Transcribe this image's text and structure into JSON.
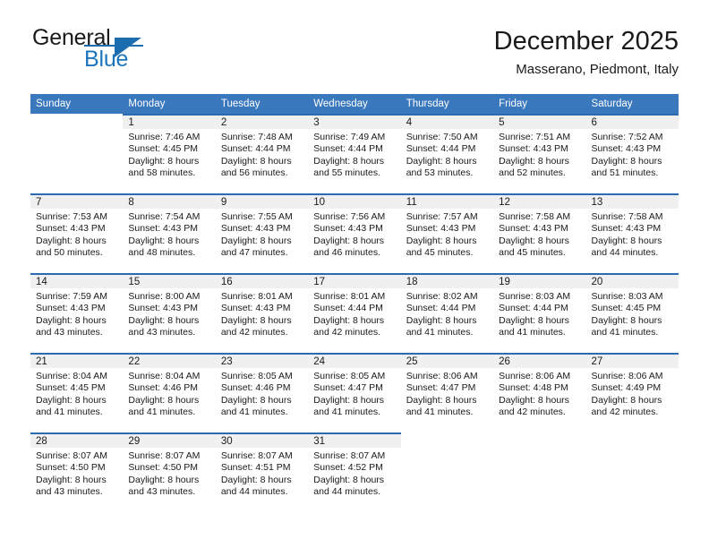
{
  "brand": {
    "name_part1": "General",
    "name_part2": "Blue",
    "logo_icon": "triangle-logo-icon",
    "accent_color": "#1c6cb0"
  },
  "header": {
    "month_title": "December 2025",
    "location": "Masserano, Piedmont, Italy"
  },
  "calendar": {
    "header_background": "#3a78bd",
    "daynum_band_background": "#f0f0f0",
    "daynum_band_border": "#2b6cb0",
    "weekday_headers": [
      "Sunday",
      "Monday",
      "Tuesday",
      "Wednesday",
      "Thursday",
      "Friday",
      "Saturday"
    ],
    "weeks": [
      [
        {
          "day": "",
          "sunrise": "",
          "sunset": "",
          "daylight_line1": "",
          "daylight_line2": ""
        },
        {
          "day": "1",
          "sunrise": "Sunrise: 7:46 AM",
          "sunset": "Sunset: 4:45 PM",
          "daylight_line1": "Daylight: 8 hours",
          "daylight_line2": "and 58 minutes."
        },
        {
          "day": "2",
          "sunrise": "Sunrise: 7:48 AM",
          "sunset": "Sunset: 4:44 PM",
          "daylight_line1": "Daylight: 8 hours",
          "daylight_line2": "and 56 minutes."
        },
        {
          "day": "3",
          "sunrise": "Sunrise: 7:49 AM",
          "sunset": "Sunset: 4:44 PM",
          "daylight_line1": "Daylight: 8 hours",
          "daylight_line2": "and 55 minutes."
        },
        {
          "day": "4",
          "sunrise": "Sunrise: 7:50 AM",
          "sunset": "Sunset: 4:44 PM",
          "daylight_line1": "Daylight: 8 hours",
          "daylight_line2": "and 53 minutes."
        },
        {
          "day": "5",
          "sunrise": "Sunrise: 7:51 AM",
          "sunset": "Sunset: 4:43 PM",
          "daylight_line1": "Daylight: 8 hours",
          "daylight_line2": "and 52 minutes."
        },
        {
          "day": "6",
          "sunrise": "Sunrise: 7:52 AM",
          "sunset": "Sunset: 4:43 PM",
          "daylight_line1": "Daylight: 8 hours",
          "daylight_line2": "and 51 minutes."
        }
      ],
      [
        {
          "day": "7",
          "sunrise": "Sunrise: 7:53 AM",
          "sunset": "Sunset: 4:43 PM",
          "daylight_line1": "Daylight: 8 hours",
          "daylight_line2": "and 50 minutes."
        },
        {
          "day": "8",
          "sunrise": "Sunrise: 7:54 AM",
          "sunset": "Sunset: 4:43 PM",
          "daylight_line1": "Daylight: 8 hours",
          "daylight_line2": "and 48 minutes."
        },
        {
          "day": "9",
          "sunrise": "Sunrise: 7:55 AM",
          "sunset": "Sunset: 4:43 PM",
          "daylight_line1": "Daylight: 8 hours",
          "daylight_line2": "and 47 minutes."
        },
        {
          "day": "10",
          "sunrise": "Sunrise: 7:56 AM",
          "sunset": "Sunset: 4:43 PM",
          "daylight_line1": "Daylight: 8 hours",
          "daylight_line2": "and 46 minutes."
        },
        {
          "day": "11",
          "sunrise": "Sunrise: 7:57 AM",
          "sunset": "Sunset: 4:43 PM",
          "daylight_line1": "Daylight: 8 hours",
          "daylight_line2": "and 45 minutes."
        },
        {
          "day": "12",
          "sunrise": "Sunrise: 7:58 AM",
          "sunset": "Sunset: 4:43 PM",
          "daylight_line1": "Daylight: 8 hours",
          "daylight_line2": "and 45 minutes."
        },
        {
          "day": "13",
          "sunrise": "Sunrise: 7:58 AM",
          "sunset": "Sunset: 4:43 PM",
          "daylight_line1": "Daylight: 8 hours",
          "daylight_line2": "and 44 minutes."
        }
      ],
      [
        {
          "day": "14",
          "sunrise": "Sunrise: 7:59 AM",
          "sunset": "Sunset: 4:43 PM",
          "daylight_line1": "Daylight: 8 hours",
          "daylight_line2": "and 43 minutes."
        },
        {
          "day": "15",
          "sunrise": "Sunrise: 8:00 AM",
          "sunset": "Sunset: 4:43 PM",
          "daylight_line1": "Daylight: 8 hours",
          "daylight_line2": "and 43 minutes."
        },
        {
          "day": "16",
          "sunrise": "Sunrise: 8:01 AM",
          "sunset": "Sunset: 4:43 PM",
          "daylight_line1": "Daylight: 8 hours",
          "daylight_line2": "and 42 minutes."
        },
        {
          "day": "17",
          "sunrise": "Sunrise: 8:01 AM",
          "sunset": "Sunset: 4:44 PM",
          "daylight_line1": "Daylight: 8 hours",
          "daylight_line2": "and 42 minutes."
        },
        {
          "day": "18",
          "sunrise": "Sunrise: 8:02 AM",
          "sunset": "Sunset: 4:44 PM",
          "daylight_line1": "Daylight: 8 hours",
          "daylight_line2": "and 41 minutes."
        },
        {
          "day": "19",
          "sunrise": "Sunrise: 8:03 AM",
          "sunset": "Sunset: 4:44 PM",
          "daylight_line1": "Daylight: 8 hours",
          "daylight_line2": "and 41 minutes."
        },
        {
          "day": "20",
          "sunrise": "Sunrise: 8:03 AM",
          "sunset": "Sunset: 4:45 PM",
          "daylight_line1": "Daylight: 8 hours",
          "daylight_line2": "and 41 minutes."
        }
      ],
      [
        {
          "day": "21",
          "sunrise": "Sunrise: 8:04 AM",
          "sunset": "Sunset: 4:45 PM",
          "daylight_line1": "Daylight: 8 hours",
          "daylight_line2": "and 41 minutes."
        },
        {
          "day": "22",
          "sunrise": "Sunrise: 8:04 AM",
          "sunset": "Sunset: 4:46 PM",
          "daylight_line1": "Daylight: 8 hours",
          "daylight_line2": "and 41 minutes."
        },
        {
          "day": "23",
          "sunrise": "Sunrise: 8:05 AM",
          "sunset": "Sunset: 4:46 PM",
          "daylight_line1": "Daylight: 8 hours",
          "daylight_line2": "and 41 minutes."
        },
        {
          "day": "24",
          "sunrise": "Sunrise: 8:05 AM",
          "sunset": "Sunset: 4:47 PM",
          "daylight_line1": "Daylight: 8 hours",
          "daylight_line2": "and 41 minutes."
        },
        {
          "day": "25",
          "sunrise": "Sunrise: 8:06 AM",
          "sunset": "Sunset: 4:47 PM",
          "daylight_line1": "Daylight: 8 hours",
          "daylight_line2": "and 41 minutes."
        },
        {
          "day": "26",
          "sunrise": "Sunrise: 8:06 AM",
          "sunset": "Sunset: 4:48 PM",
          "daylight_line1": "Daylight: 8 hours",
          "daylight_line2": "and 42 minutes."
        },
        {
          "day": "27",
          "sunrise": "Sunrise: 8:06 AM",
          "sunset": "Sunset: 4:49 PM",
          "daylight_line1": "Daylight: 8 hours",
          "daylight_line2": "and 42 minutes."
        }
      ],
      [
        {
          "day": "28",
          "sunrise": "Sunrise: 8:07 AM",
          "sunset": "Sunset: 4:50 PM",
          "daylight_line1": "Daylight: 8 hours",
          "daylight_line2": "and 43 minutes."
        },
        {
          "day": "29",
          "sunrise": "Sunrise: 8:07 AM",
          "sunset": "Sunset: 4:50 PM",
          "daylight_line1": "Daylight: 8 hours",
          "daylight_line2": "and 43 minutes."
        },
        {
          "day": "30",
          "sunrise": "Sunrise: 8:07 AM",
          "sunset": "Sunset: 4:51 PM",
          "daylight_line1": "Daylight: 8 hours",
          "daylight_line2": "and 44 minutes."
        },
        {
          "day": "31",
          "sunrise": "Sunrise: 8:07 AM",
          "sunset": "Sunset: 4:52 PM",
          "daylight_line1": "Daylight: 8 hours",
          "daylight_line2": "and 44 minutes."
        },
        {
          "day": "",
          "sunrise": "",
          "sunset": "",
          "daylight_line1": "",
          "daylight_line2": ""
        },
        {
          "day": "",
          "sunrise": "",
          "sunset": "",
          "daylight_line1": "",
          "daylight_line2": ""
        },
        {
          "day": "",
          "sunrise": "",
          "sunset": "",
          "daylight_line1": "",
          "daylight_line2": ""
        }
      ]
    ]
  }
}
